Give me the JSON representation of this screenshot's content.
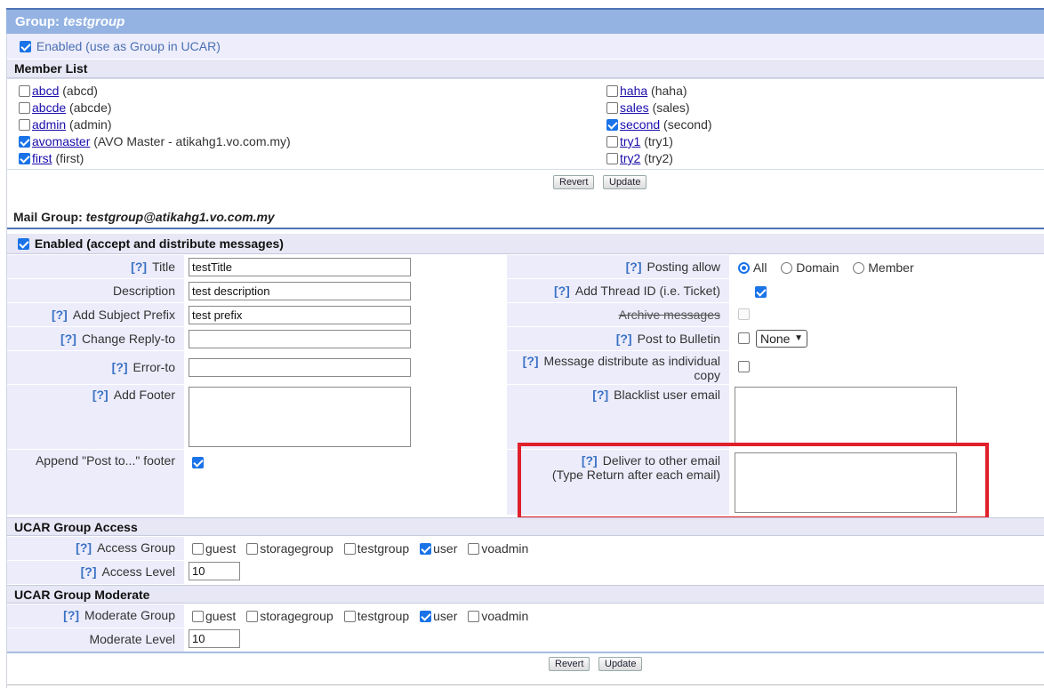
{
  "group_header": {
    "prefix": "Group: ",
    "name": "testgroup"
  },
  "enabled_ucar": {
    "checked": true,
    "label": "Enabled (use as Group in UCAR)"
  },
  "member_list": {
    "title": "Member List",
    "left": [
      {
        "user": "abcd",
        "name": "(abcd)",
        "checked": false
      },
      {
        "user": "abcde",
        "name": "(abcde)",
        "checked": false
      },
      {
        "user": "admin",
        "name": "(admin)",
        "checked": false
      },
      {
        "user": "avomaster",
        "name": "(AVO Master - atikahg1.vo.com.my)",
        "checked": true
      },
      {
        "user": "first",
        "name": "(first)",
        "checked": true
      }
    ],
    "right": [
      {
        "user": "haha",
        "name": "(haha)",
        "checked": false
      },
      {
        "user": "sales",
        "name": "(sales)",
        "checked": false
      },
      {
        "user": "second",
        "name": "(second)",
        "checked": true
      },
      {
        "user": "try1",
        "name": "(try1)",
        "checked": false
      },
      {
        "user": "try2",
        "name": "(try2)",
        "checked": false
      }
    ],
    "revert": "Revert",
    "update": "Update"
  },
  "mail_group": {
    "prefix": "Mail Group: ",
    "address": "testgroup@atikahg1.vo.com.my"
  },
  "mail_enabled": {
    "checked": true,
    "label": "Enabled (accept and distribute messages)"
  },
  "help": "[?]",
  "fields": {
    "title": {
      "label": "Title",
      "value": "testTitle"
    },
    "description": {
      "label": "Description",
      "value": "test description"
    },
    "subject_prefix": {
      "label": "Add Subject Prefix",
      "value": "test prefix"
    },
    "reply_to": {
      "label": "Change Reply-to",
      "value": ""
    },
    "error_to": {
      "label": "Error-to",
      "value": ""
    },
    "footer": {
      "label": "Add Footer",
      "value": ""
    },
    "append_footer": {
      "label": "Append \"Post to...\" footer",
      "checked": true
    },
    "posting_allow": {
      "label": "Posting allow",
      "options": [
        "All",
        "Domain",
        "Member"
      ],
      "selected": "All"
    },
    "thread_id": {
      "label": "Add Thread ID (i.e. Ticket)",
      "checked": true
    },
    "archive": {
      "label": "Archive messages",
      "checked": false,
      "disabled": true
    },
    "bulletin": {
      "label": "Post to Bulletin",
      "checked": false,
      "select": "None"
    },
    "individual": {
      "label1": "Message distribute as individual",
      "label2": "copy",
      "checked": false
    },
    "blacklist": {
      "label": "Blacklist user email",
      "value": ""
    },
    "deliver": {
      "label1": "Deliver to other email",
      "label2": "(Type Return after each email)",
      "value": ""
    }
  },
  "ucar_access": {
    "title": "UCAR Group Access",
    "group_label": "Access Group",
    "groups": [
      {
        "name": "guest",
        "checked": false
      },
      {
        "name": "storagegroup",
        "checked": false
      },
      {
        "name": "testgroup",
        "checked": false
      },
      {
        "name": "user",
        "checked": true
      },
      {
        "name": "voadmin",
        "checked": false
      }
    ],
    "level_label": "Access Level",
    "level": "10"
  },
  "ucar_moderate": {
    "title": "UCAR Group Moderate",
    "group_label": "Moderate Group",
    "groups": [
      {
        "name": "guest",
        "checked": false
      },
      {
        "name": "storagegroup",
        "checked": false
      },
      {
        "name": "testgroup",
        "checked": false
      },
      {
        "name": "user",
        "checked": true
      },
      {
        "name": "voadmin",
        "checked": false
      }
    ],
    "level_label": "Moderate Level",
    "level": "10"
  },
  "bottom": {
    "revert": "Revert",
    "update": "Update"
  },
  "highlight_color": "#e0202a"
}
